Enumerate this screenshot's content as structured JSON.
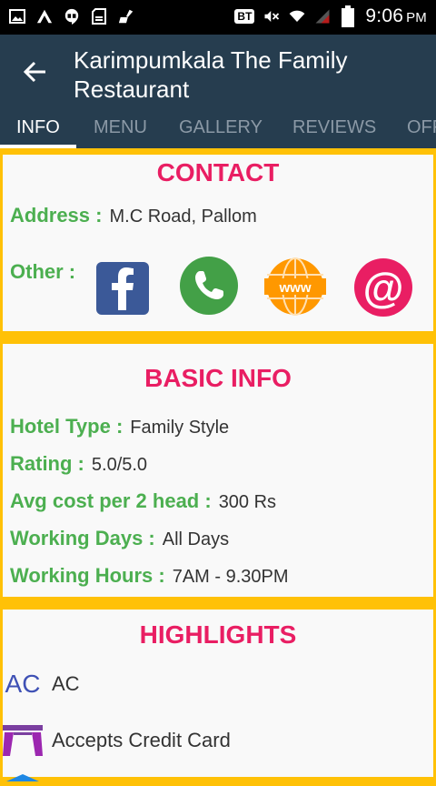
{
  "statusbar": {
    "time": "9:06",
    "ampm": "PM",
    "bt_label": "BT",
    "icons": [
      "image-icon",
      "a-icon",
      "hangouts-icon",
      "sd-card-icon",
      "broom-icon",
      "bluetooth-icon",
      "mute-icon",
      "wifi-icon",
      "signal-icon",
      "battery-icon"
    ]
  },
  "appbar": {
    "title": "Karimpumkala The Family Restaurant",
    "tabs": [
      "INFO",
      "MENU",
      "GALLERY",
      "REVIEWS",
      "OFF"
    ],
    "active_tab": 0
  },
  "contact": {
    "title": "CONTACT",
    "address_label": "Address :",
    "address_value": "M.C Road, Pallom",
    "other_label": "Other :",
    "icons": [
      "facebook-icon",
      "phone-icon",
      "www-icon",
      "email-icon"
    ]
  },
  "basic_info": {
    "title": "BASIC INFO",
    "rows": [
      {
        "label": "Hotel Type :",
        "value": "Family Style"
      },
      {
        "label": "Rating :",
        "value": "5.0/5.0"
      },
      {
        "label": "Avg cost per 2 head :",
        "value": "300 Rs"
      },
      {
        "label": "Working Days :",
        "value": "All Days"
      },
      {
        "label": "Working Hours :",
        "value": "7AM - 9.30PM"
      }
    ]
  },
  "highlights": {
    "title": "HIGHLIGHTS",
    "ac_icon_text": "AC",
    "items": [
      "AC",
      "Accepts Credit Card"
    ]
  },
  "colors": {
    "appbar": "#263d4f",
    "accent": "#e91e63",
    "label_green": "#4caf50",
    "card_border": "#ffc107"
  }
}
